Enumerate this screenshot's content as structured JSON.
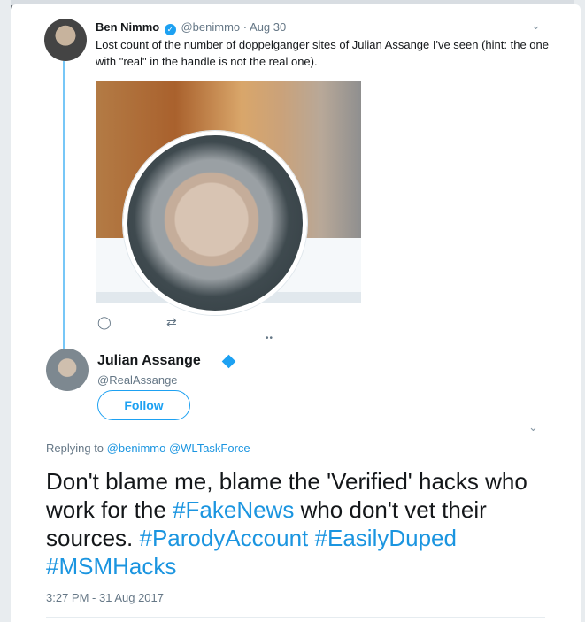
{
  "tweet1": {
    "name": "Ben Nimmo",
    "handle": "@benimmo",
    "separator": "·",
    "date": "Aug 30",
    "text": "Lost count of the number of doppelganger sites of Julian Assange I've seen (hint: the one with \"real\" in the handle is not the real one)."
  },
  "tweet2": {
    "name": "Julian Assange",
    "handle": "@RealAssange",
    "follow_label": "Follow",
    "replying_prefix": "Replying to",
    "replying_to_1": "@benimmo",
    "replying_to_2": "@WLTaskForce",
    "text_part1": "Don't blame me, blame the 'Verified' hacks who work for the ",
    "hashtag1": "#FakeNews",
    "text_part2": " who don't vet their sources. ",
    "hashtag2": "#ParodyAccount",
    "hashtag3": "#EasilyDuped",
    "hashtag4": "#MSMHacks",
    "timestamp": "3:27 PM - 31 Aug 2017"
  },
  "icons": {
    "verified": "verified-badge-icon",
    "reply": "reply-icon",
    "retweet": "retweet-icon",
    "chevron": "chevron-down-icon",
    "more": "more-icon",
    "diamond": "blue-diamond-icon"
  },
  "colors": {
    "accent": "#1da1f2",
    "link": "#1b95e0",
    "muted": "#657786",
    "text": "#14171a"
  }
}
